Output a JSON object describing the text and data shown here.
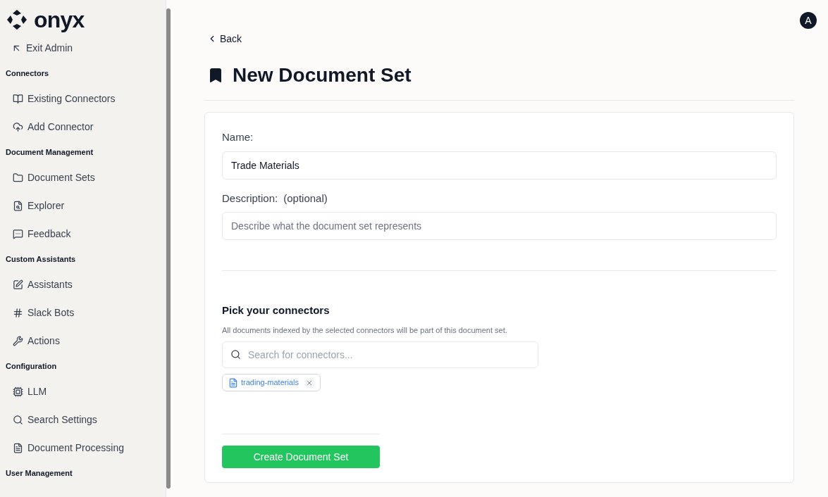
{
  "logo": {
    "text": "onyx"
  },
  "sidebar": {
    "top_item": {
      "label": "Exit Admin"
    },
    "sections": [
      {
        "title": "Connectors",
        "items": [
          {
            "label": "Existing Connectors"
          },
          {
            "label": "Add Connector"
          }
        ]
      },
      {
        "title": "Document Management",
        "items": [
          {
            "label": "Document Sets"
          },
          {
            "label": "Explorer"
          },
          {
            "label": "Feedback"
          }
        ]
      },
      {
        "title": "Custom Assistants",
        "items": [
          {
            "label": "Assistants"
          },
          {
            "label": "Slack Bots"
          },
          {
            "label": "Actions"
          }
        ]
      },
      {
        "title": "Configuration",
        "items": [
          {
            "label": "LLM"
          },
          {
            "label": "Search Settings"
          },
          {
            "label": "Document Processing"
          }
        ]
      },
      {
        "title": "User Management"
      }
    ]
  },
  "user_avatar": {
    "initial": "A"
  },
  "back_link": "Back",
  "page_title": "New Document Set",
  "form": {
    "name": {
      "label": "Name:",
      "value": "Trade Materials"
    },
    "description": {
      "label": "Description:",
      "optional": "(optional)",
      "placeholder": "Describe what the document set represents"
    },
    "connectors": {
      "title": "Pick your connectors",
      "hint": "All documents indexed by the selected connectors will be part of this document set.",
      "search_placeholder": "Search for connectors...",
      "selected": [
        {
          "label": "trading-materials"
        }
      ]
    },
    "submit": "Create Document Set"
  }
}
